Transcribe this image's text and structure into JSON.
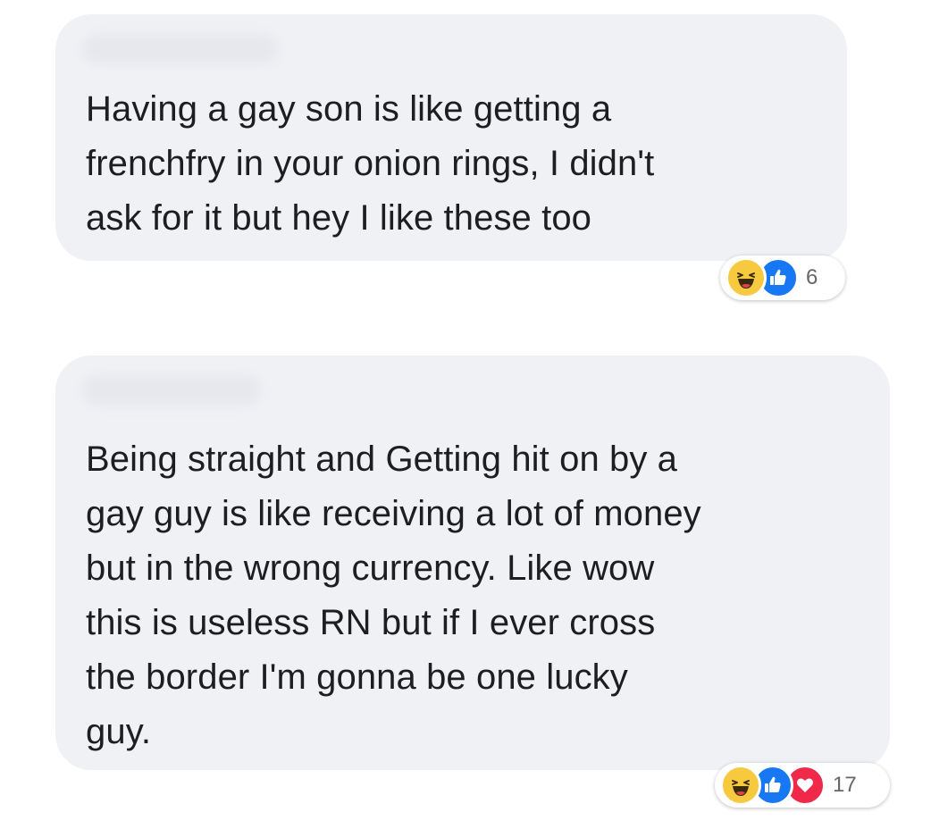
{
  "comments": [
    {
      "text": "Having a gay son is like getting a\nfrenchfry in your onion rings, I didn't\nask for it but hey I like these too",
      "reactions": {
        "icons": [
          "haha-icon",
          "like-icon"
        ],
        "count": "6"
      }
    },
    {
      "text": "Being straight and Getting hit on by a\ngay guy is like receiving a lot of money\nbut in the wrong currency. Like wow\nthis is useless RN but if I ever cross\nthe border I'm gonna be one lucky\nguy.",
      "reactions": {
        "icons": [
          "haha-icon",
          "like-icon",
          "love-icon"
        ],
        "count": "17"
      }
    }
  ],
  "colors": {
    "bubble": "#f0f1f5",
    "text": "#1c1e21",
    "like": "#1877f2",
    "love": "#f0284a",
    "haha": "#f7c93e",
    "count": "#65676b"
  }
}
